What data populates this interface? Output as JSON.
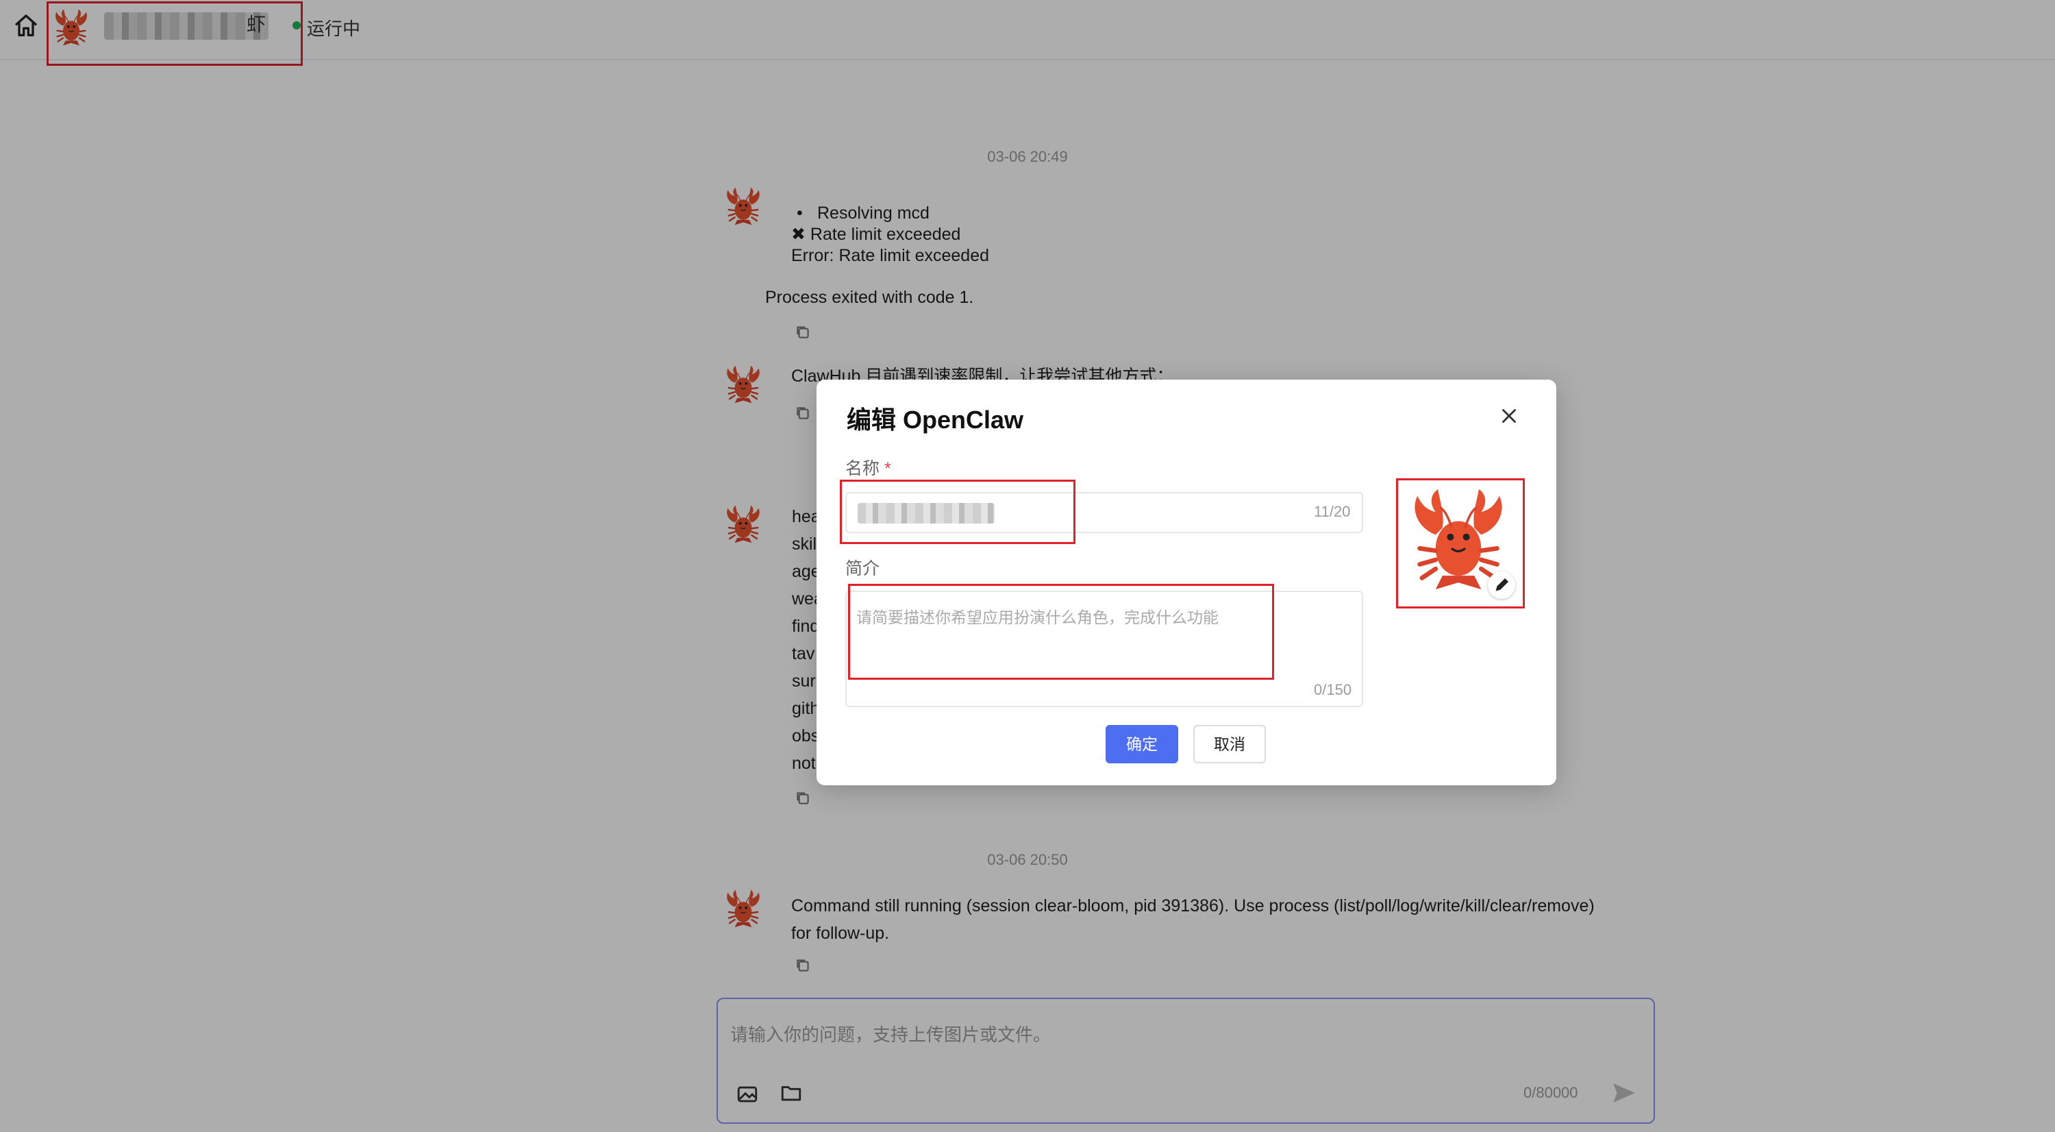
{
  "header": {
    "agent_name_visible_suffix": "虾",
    "status": "运行中"
  },
  "chat": {
    "timestamps": [
      "03-06 20:49",
      "03-06 20:50"
    ],
    "msg1": {
      "bullet": "Resolving mcd",
      "line2": "✖ Rate limit exceeded",
      "line3": "Error: Rate limit exceeded",
      "line4": "Process exited with code 1."
    },
    "msg2": {
      "text": "ClawHub 目前遇到速率限制，让我尝试其他方式："
    },
    "msg3": {
      "fragments": [
        "hea",
        "skil",
        "age",
        "wea",
        "find",
        "tav",
        "sur",
        "gith",
        "obs",
        "not"
      ]
    },
    "msg4": {
      "line1": "Command still running (session clear-bloom, pid 391386). Use process (list/poll/log/write/kill/clear/remove)",
      "line2": "for follow-up."
    }
  },
  "input": {
    "placeholder": "请输入你的问题，支持上传图片或文件。",
    "counter": "0/80000"
  },
  "modal": {
    "title": "编辑 OpenClaw",
    "name_label": "名称",
    "required_mark": "*",
    "name_counter": "11/20",
    "intro_label": "简介",
    "intro_placeholder": "请简要描述你希望应用扮演什么角色，完成什么功能",
    "intro_counter": "0/150",
    "confirm": "确定",
    "cancel": "取消"
  },
  "colors": {
    "primary": "#4e6ef2",
    "status_green": "#26b25a",
    "highlight_red": "#e0222a",
    "lobster": "#e8512f"
  }
}
